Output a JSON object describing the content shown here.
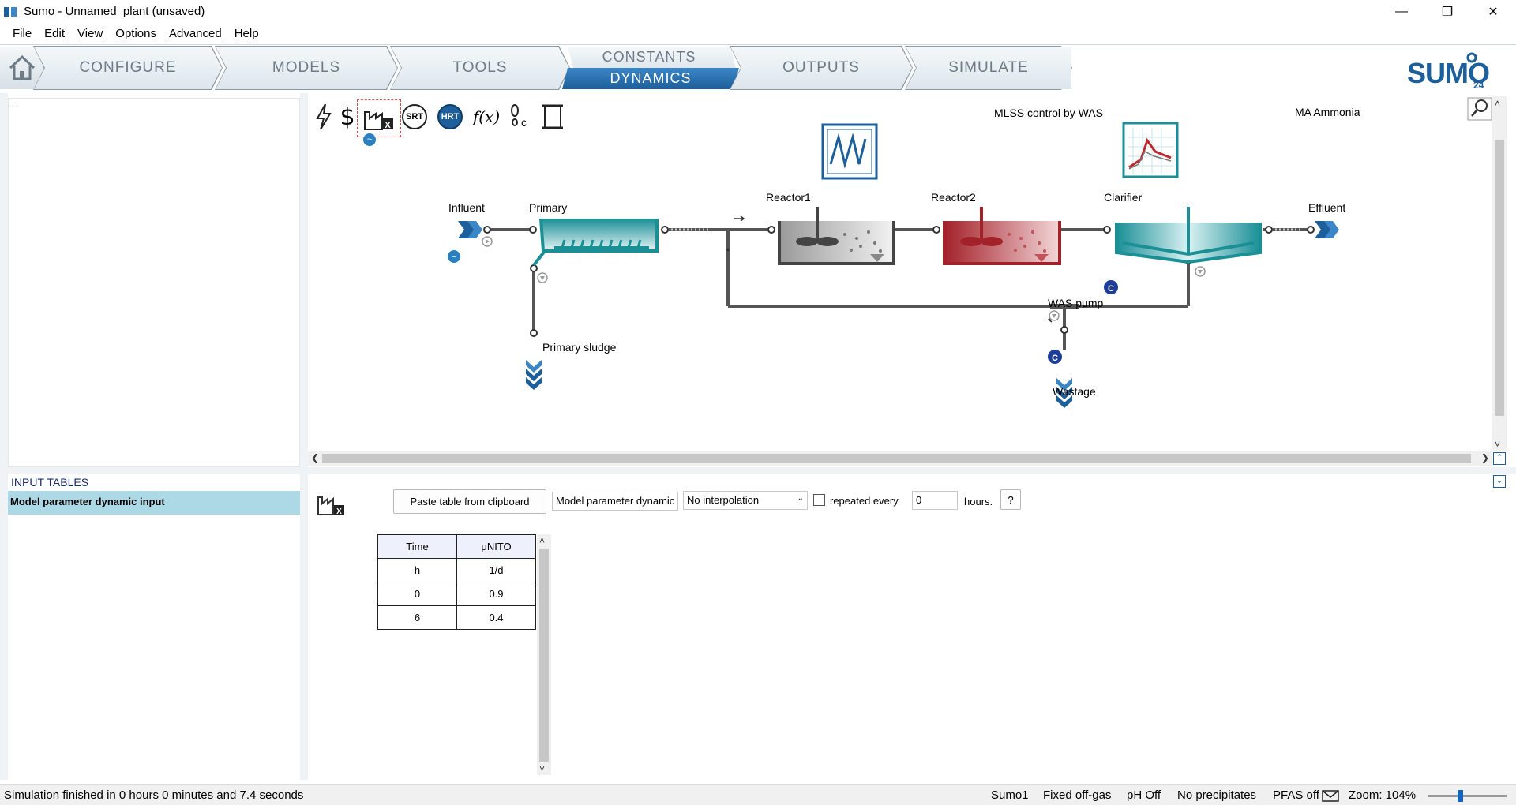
{
  "window": {
    "title": "Sumo - Unnamed_plant (unsaved)"
  },
  "menu": [
    "File",
    "Edit",
    "View",
    "Options",
    "Advanced",
    "Help"
  ],
  "nav": {
    "tabs": {
      "configure": "CONFIGURE",
      "models": "MODELS",
      "tools": "TOOLS",
      "constants": "CONSTANTS",
      "dynamics": "DYNAMICS",
      "outputs": "OUTPUTS",
      "simulate": "SIMULATE"
    },
    "active": "DYNAMICS",
    "logo_text": "SUMO",
    "logo_version": "24"
  },
  "left_top": {
    "placeholder": "-"
  },
  "toolbar_icons": [
    "lightning-icon",
    "dollar-icon",
    "dynamic-input-table-icon",
    "srt-icon",
    "hrt-icon",
    "function-icon",
    "footprint-icon",
    "scroll-icon"
  ],
  "toolbar_labels": {
    "srt": "SRT",
    "hrt": "HRT",
    "fx": "f(x)"
  },
  "diagram": {
    "units": {
      "influent": "Influent",
      "primary": "Primary",
      "reactor1": "Reactor1",
      "reactor2": "Reactor2",
      "clarifier": "Clarifier",
      "effluent": "Effluent",
      "primary_sludge": "Primary sludge",
      "was_pump": "WAS pump",
      "wastage": "Wastage"
    },
    "controllers": {
      "mlss": "MLSS control by WAS",
      "ammonia": "MA Ammonia"
    },
    "controller_badge": "C"
  },
  "input_tables": {
    "header": "INPUT TABLES",
    "items": [
      "Model parameter dynamic input"
    ],
    "selected": "Model parameter dynamic input"
  },
  "editor": {
    "paste_button": "Paste table from clipboard",
    "table_name": "Model parameter dynamic",
    "interpolation": "No interpolation",
    "repeat_label": "repeated every",
    "repeat_checked": false,
    "repeat_value": "0",
    "repeat_unit": "hours.",
    "help_button": "?",
    "table": {
      "headers": [
        "Time",
        "μNITO"
      ],
      "units": [
        "h",
        "1/d"
      ],
      "rows": [
        [
          "0",
          "0.9"
        ],
        [
          "6",
          "0.4"
        ]
      ]
    }
  },
  "status": {
    "message": "Simulation finished in 0 hours 0 minutes and 7.4 seconds",
    "model": "Sumo1",
    "offgas": "Fixed off-gas",
    "ph": "pH Off",
    "precipitates": "No precipitates",
    "pfas": "PFAS off",
    "zoom": "Zoom: 104%",
    "zoom_level_percent": 104
  },
  "colors": {
    "accent_blue": "#1d5f9a",
    "teal": "#1a8f96",
    "reactor_red": "#a3222a",
    "pipe": "#555555",
    "selection_blue": "#add8e6"
  }
}
